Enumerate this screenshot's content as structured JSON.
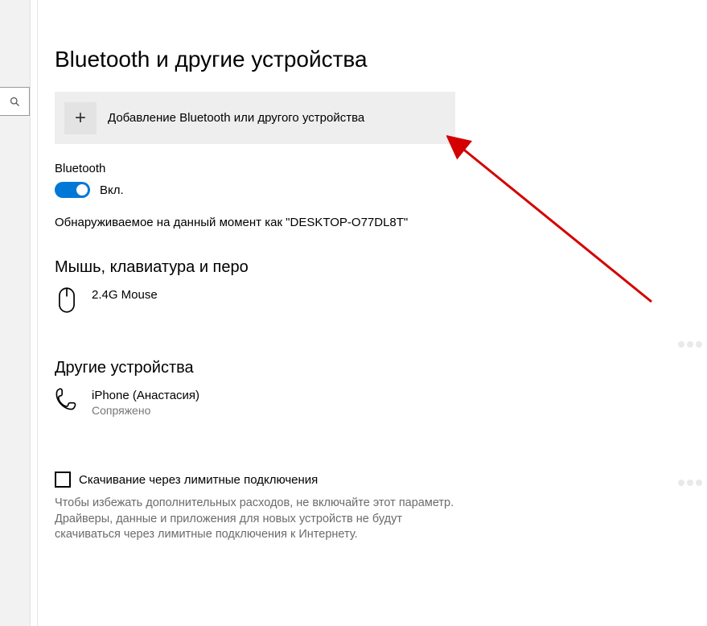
{
  "page_title": "Bluetooth и другие устройства",
  "add_device": {
    "label": "Добавление Bluetooth или другого устройства"
  },
  "bluetooth": {
    "label": "Bluetooth",
    "state_label": "Вкл.",
    "discoverable_text": "Обнаруживаемое на данный момент как \"DESKTOP-O77DL8T\""
  },
  "section_mouse": {
    "title": "Мышь, клавиатура и перо",
    "devices": [
      {
        "name": "2.4G Mouse",
        "status": ""
      }
    ]
  },
  "section_other": {
    "title": "Другие устройства",
    "devices": [
      {
        "name": "iPhone (Анастасия)",
        "status": "Сопряжено"
      }
    ]
  },
  "metered": {
    "checkbox_label": "Скачивание через лимитные подключения",
    "help": "Чтобы избежать дополнительных расходов, не включайте этот параметр. Драйверы, данные и приложения для новых устройств не будут скачиваться через лимитные подключения к Интернету."
  }
}
